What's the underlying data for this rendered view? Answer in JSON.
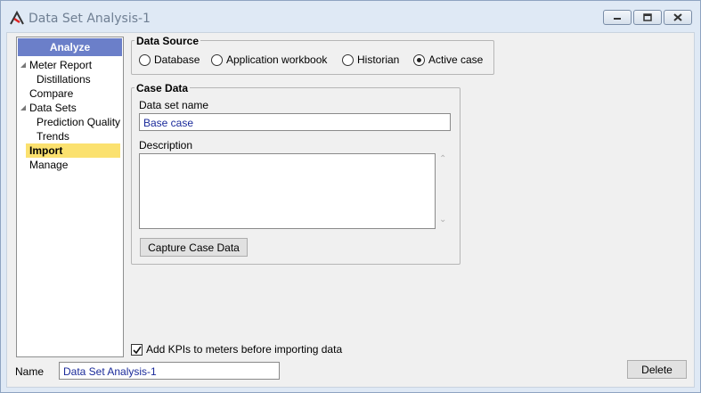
{
  "window": {
    "title": "Data Set Analysis-1",
    "icon": "app-logo-icon",
    "controls": [
      "minimize-icon",
      "restore-icon",
      "close-icon"
    ]
  },
  "nav": {
    "header": "Analyze",
    "items": [
      {
        "label": "Meter Report",
        "level": 0,
        "expandable": true
      },
      {
        "label": "Distillations",
        "level": 1
      },
      {
        "label": "Compare",
        "level": 0
      },
      {
        "label": "Data Sets",
        "level": 0,
        "expandable": true
      },
      {
        "label": "Prediction Quality",
        "level": 1
      },
      {
        "label": "Trends",
        "level": 1
      },
      {
        "label": "Import",
        "level": 0,
        "selected": true
      },
      {
        "label": "Manage",
        "level": 0
      }
    ]
  },
  "data_source": {
    "title": "Data Source",
    "options": [
      {
        "label": "Database",
        "checked": false
      },
      {
        "label": "Application workbook",
        "checked": false
      },
      {
        "label": "Historian",
        "checked": false
      },
      {
        "label": "Active case",
        "checked": true
      }
    ]
  },
  "case_data": {
    "title": "Case Data",
    "name_label": "Data set name",
    "name_value": "Base case",
    "description_label": "Description",
    "description_value": "",
    "capture_button": "Capture Case Data"
  },
  "footer": {
    "checkbox_label": "Add KPIs to meters before importing data",
    "checkbox_checked": true,
    "name_label": "Name",
    "name_value": "Data Set Analysis-1",
    "delete_button": "Delete"
  },
  "colors": {
    "nav_header": "#6b7fc9",
    "selected_item": "#fbe16f",
    "input_text": "#1a2a9a"
  }
}
